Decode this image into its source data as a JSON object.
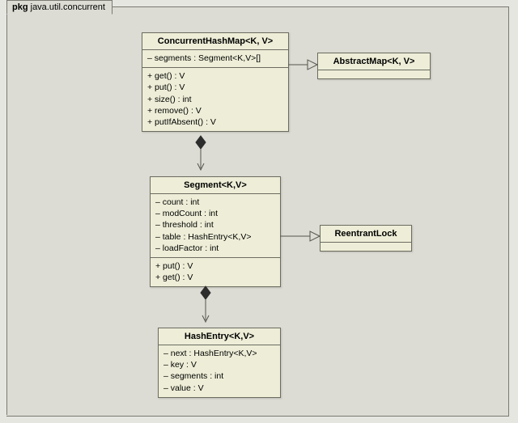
{
  "package": {
    "prefix": "pkg",
    "name": "java.util.concurrent"
  },
  "classes": {
    "concurrentHashMap": {
      "title": "ConcurrentHashMap<K, V>",
      "attrs": [
        "– segments : Segment<K,V>[]"
      ],
      "ops": [
        "+ get() : V",
        "+ put() : V",
        "+ size() : int",
        "+ remove() : V",
        "+ putIfAbsent() : V"
      ]
    },
    "abstractMap": {
      "title": "AbstractMap<K, V>"
    },
    "segment": {
      "title": "Segment<K,V>",
      "attrs": [
        "– count : int",
        "– modCount : int",
        "– threshold : int",
        "– table : HashEntry<K,V>",
        "– loadFactor : int"
      ],
      "ops": [
        "+ put() : V",
        "+ get() : V"
      ]
    },
    "reentrantLock": {
      "title": "ReentrantLock"
    },
    "hashEntry": {
      "title": "HashEntry<K,V>",
      "attrs": [
        "– next : HashEntry<K,V>",
        "– key : V",
        "– segments : int",
        "– value : V"
      ]
    }
  }
}
